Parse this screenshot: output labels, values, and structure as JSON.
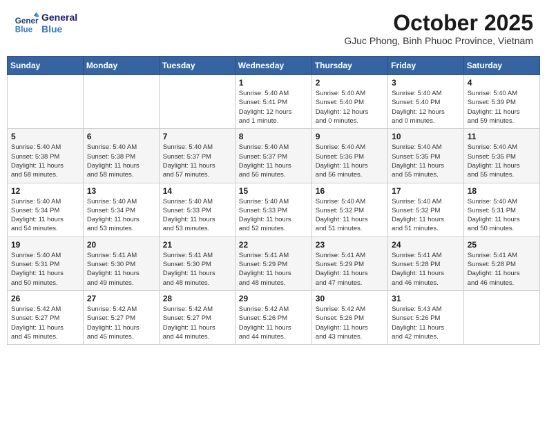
{
  "header": {
    "logo_line1": "General",
    "logo_line2": "Blue",
    "month": "October 2025",
    "location": "GJuc Phong, Binh Phuoc Province, Vietnam"
  },
  "weekdays": [
    "Sunday",
    "Monday",
    "Tuesday",
    "Wednesday",
    "Thursday",
    "Friday",
    "Saturday"
  ],
  "weeks": [
    [
      {
        "day": "",
        "info": ""
      },
      {
        "day": "",
        "info": ""
      },
      {
        "day": "",
        "info": ""
      },
      {
        "day": "1",
        "info": "Sunrise: 5:40 AM\nSunset: 5:41 PM\nDaylight: 12 hours\nand 1 minute."
      },
      {
        "day": "2",
        "info": "Sunrise: 5:40 AM\nSunset: 5:40 PM\nDaylight: 12 hours\nand 0 minutes."
      },
      {
        "day": "3",
        "info": "Sunrise: 5:40 AM\nSunset: 5:40 PM\nDaylight: 12 hours\nand 0 minutes."
      },
      {
        "day": "4",
        "info": "Sunrise: 5:40 AM\nSunset: 5:39 PM\nDaylight: 11 hours\nand 59 minutes."
      }
    ],
    [
      {
        "day": "5",
        "info": "Sunrise: 5:40 AM\nSunset: 5:38 PM\nDaylight: 11 hours\nand 58 minutes."
      },
      {
        "day": "6",
        "info": "Sunrise: 5:40 AM\nSunset: 5:38 PM\nDaylight: 11 hours\nand 58 minutes."
      },
      {
        "day": "7",
        "info": "Sunrise: 5:40 AM\nSunset: 5:37 PM\nDaylight: 11 hours\nand 57 minutes."
      },
      {
        "day": "8",
        "info": "Sunrise: 5:40 AM\nSunset: 5:37 PM\nDaylight: 11 hours\nand 56 minutes."
      },
      {
        "day": "9",
        "info": "Sunrise: 5:40 AM\nSunset: 5:36 PM\nDaylight: 11 hours\nand 56 minutes."
      },
      {
        "day": "10",
        "info": "Sunrise: 5:40 AM\nSunset: 5:35 PM\nDaylight: 11 hours\nand 55 minutes."
      },
      {
        "day": "11",
        "info": "Sunrise: 5:40 AM\nSunset: 5:35 PM\nDaylight: 11 hours\nand 55 minutes."
      }
    ],
    [
      {
        "day": "12",
        "info": "Sunrise: 5:40 AM\nSunset: 5:34 PM\nDaylight: 11 hours\nand 54 minutes."
      },
      {
        "day": "13",
        "info": "Sunrise: 5:40 AM\nSunset: 5:34 PM\nDaylight: 11 hours\nand 53 minutes."
      },
      {
        "day": "14",
        "info": "Sunrise: 5:40 AM\nSunset: 5:33 PM\nDaylight: 11 hours\nand 53 minutes."
      },
      {
        "day": "15",
        "info": "Sunrise: 5:40 AM\nSunset: 5:33 PM\nDaylight: 11 hours\nand 52 minutes."
      },
      {
        "day": "16",
        "info": "Sunrise: 5:40 AM\nSunset: 5:32 PM\nDaylight: 11 hours\nand 51 minutes."
      },
      {
        "day": "17",
        "info": "Sunrise: 5:40 AM\nSunset: 5:32 PM\nDaylight: 11 hours\nand 51 minutes."
      },
      {
        "day": "18",
        "info": "Sunrise: 5:40 AM\nSunset: 5:31 PM\nDaylight: 11 hours\nand 50 minutes."
      }
    ],
    [
      {
        "day": "19",
        "info": "Sunrise: 5:40 AM\nSunset: 5:31 PM\nDaylight: 11 hours\nand 50 minutes."
      },
      {
        "day": "20",
        "info": "Sunrise: 5:41 AM\nSunset: 5:30 PM\nDaylight: 11 hours\nand 49 minutes."
      },
      {
        "day": "21",
        "info": "Sunrise: 5:41 AM\nSunset: 5:30 PM\nDaylight: 11 hours\nand 48 minutes."
      },
      {
        "day": "22",
        "info": "Sunrise: 5:41 AM\nSunset: 5:29 PM\nDaylight: 11 hours\nand 48 minutes."
      },
      {
        "day": "23",
        "info": "Sunrise: 5:41 AM\nSunset: 5:29 PM\nDaylight: 11 hours\nand 47 minutes."
      },
      {
        "day": "24",
        "info": "Sunrise: 5:41 AM\nSunset: 5:28 PM\nDaylight: 11 hours\nand 46 minutes."
      },
      {
        "day": "25",
        "info": "Sunrise: 5:41 AM\nSunset: 5:28 PM\nDaylight: 11 hours\nand 46 minutes."
      }
    ],
    [
      {
        "day": "26",
        "info": "Sunrise: 5:42 AM\nSunset: 5:27 PM\nDaylight: 11 hours\nand 45 minutes."
      },
      {
        "day": "27",
        "info": "Sunrise: 5:42 AM\nSunset: 5:27 PM\nDaylight: 11 hours\nand 45 minutes."
      },
      {
        "day": "28",
        "info": "Sunrise: 5:42 AM\nSunset: 5:27 PM\nDaylight: 11 hours\nand 44 minutes."
      },
      {
        "day": "29",
        "info": "Sunrise: 5:42 AM\nSunset: 5:26 PM\nDaylight: 11 hours\nand 44 minutes."
      },
      {
        "day": "30",
        "info": "Sunrise: 5:42 AM\nSunset: 5:26 PM\nDaylight: 11 hours\nand 43 minutes."
      },
      {
        "day": "31",
        "info": "Sunrise: 5:43 AM\nSunset: 5:26 PM\nDaylight: 11 hours\nand 42 minutes."
      },
      {
        "day": "",
        "info": ""
      }
    ]
  ]
}
